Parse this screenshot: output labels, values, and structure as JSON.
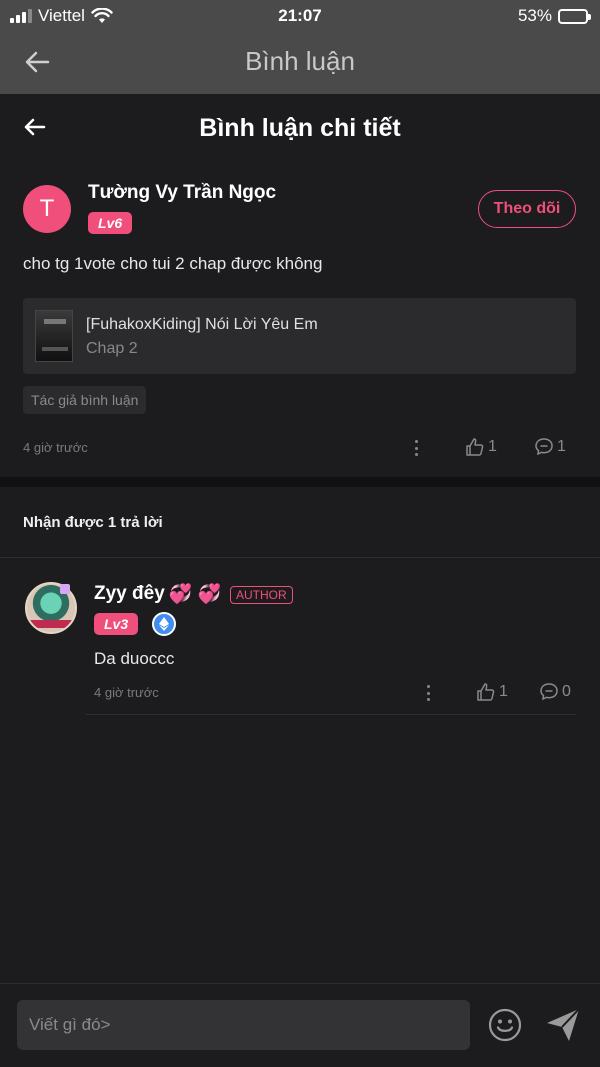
{
  "status_bar": {
    "carrier": "Viettel",
    "time": "21:07",
    "battery": "53%",
    "battery_level": 0.53
  },
  "app_bar": {
    "title": "Bình luận"
  },
  "sheet": {
    "title": "Bình luận chi tiết"
  },
  "comment": {
    "avatar_letter": "T",
    "author": "Tường Vy Trần Ngọc",
    "level": "Lv6",
    "follow_label": "Theo dõi",
    "text": "cho tg 1vote cho tui 2 chap được không",
    "story_title": "[FuhakoxKiding] Nói Lời Yêu Em",
    "story_chapter": "Chap 2",
    "tag": "Tác giả bình luận",
    "time": "4 giờ trước",
    "likes": "1",
    "replies": "1"
  },
  "replies_header": "Nhận được 1 trả lời",
  "reply": {
    "author": "Zyy đêy",
    "hearts": "💞 💞",
    "author_badge": "AUTHOR",
    "level": "Lv3",
    "text": "Da duoccc",
    "time": "4 giờ trước",
    "likes": "1",
    "replies": "0"
  },
  "input": {
    "placeholder": "Viết gì đó>"
  },
  "colors": {
    "accent": "#ef4f7a",
    "background": "#1c1c1e",
    "header": "#4a4a4a"
  }
}
